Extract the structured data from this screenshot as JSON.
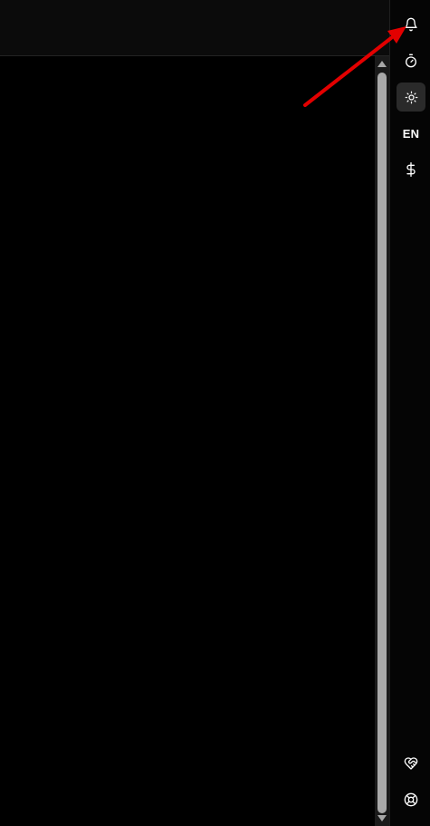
{
  "rail": {
    "language": "EN",
    "items": [
      {
        "name": "notifications",
        "icon": "bell-icon"
      },
      {
        "name": "timer",
        "icon": "stopwatch-icon"
      },
      {
        "name": "theme",
        "icon": "sun-icon",
        "active": true
      },
      {
        "name": "language",
        "icon": "language-label"
      },
      {
        "name": "currency",
        "icon": "dollar-icon"
      },
      {
        "name": "favorites",
        "icon": "heart-handshake-icon"
      },
      {
        "name": "support",
        "icon": "lifebuoy-icon"
      }
    ]
  },
  "colors": {
    "background": "#000000",
    "panel": "#0b0b0b",
    "icon": "#ffffff",
    "active_bg": "#2a2a2a",
    "scroll_thumb": "#a9a9a9",
    "annotation_arrow": "#e30000"
  }
}
